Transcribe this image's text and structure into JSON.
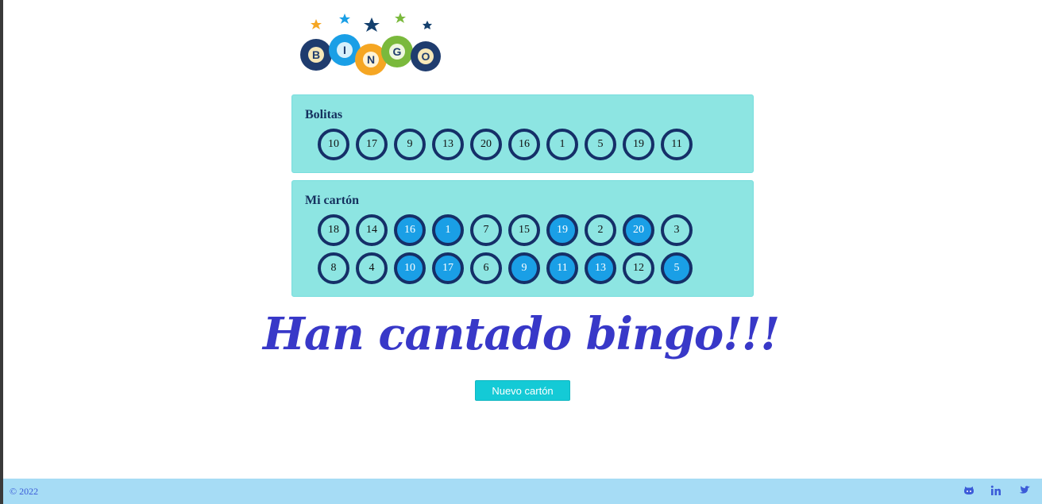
{
  "logo": {
    "letters": [
      "B",
      "I",
      "N",
      "G",
      "O"
    ]
  },
  "bolitas": {
    "title": "Bolitas",
    "numbers": [
      "10",
      "17",
      "9",
      "13",
      "20",
      "16",
      "1",
      "5",
      "19",
      "11"
    ]
  },
  "carton": {
    "title": "Mi cartón",
    "rows": [
      [
        {
          "n": "18",
          "marked": false
        },
        {
          "n": "14",
          "marked": false
        },
        {
          "n": "16",
          "marked": true
        },
        {
          "n": "1",
          "marked": true
        },
        {
          "n": "7",
          "marked": false
        },
        {
          "n": "15",
          "marked": false
        },
        {
          "n": "19",
          "marked": true
        },
        {
          "n": "2",
          "marked": false
        },
        {
          "n": "20",
          "marked": true
        },
        {
          "n": "3",
          "marked": false
        }
      ],
      [
        {
          "n": "8",
          "marked": false
        },
        {
          "n": "4",
          "marked": false
        },
        {
          "n": "10",
          "marked": true
        },
        {
          "n": "17",
          "marked": true
        },
        {
          "n": "6",
          "marked": false
        },
        {
          "n": "9",
          "marked": true
        },
        {
          "n": "11",
          "marked": true
        },
        {
          "n": "13",
          "marked": true
        },
        {
          "n": "12",
          "marked": false
        },
        {
          "n": "5",
          "marked": true
        }
      ]
    ]
  },
  "message": "Han cantado bingo!!!",
  "new_card_button": "Nuevo cartón",
  "footer": {
    "copyright": "© 2022",
    "social": [
      "github-icon",
      "linkedin-icon",
      "twitter-icon"
    ]
  },
  "colors": {
    "panel": "#8de5e2",
    "ball_border": "#152f68",
    "marked": "#1a9fe6",
    "headline": "#3838c8",
    "button": "#14cad6",
    "footer": "#a6dcf5"
  }
}
